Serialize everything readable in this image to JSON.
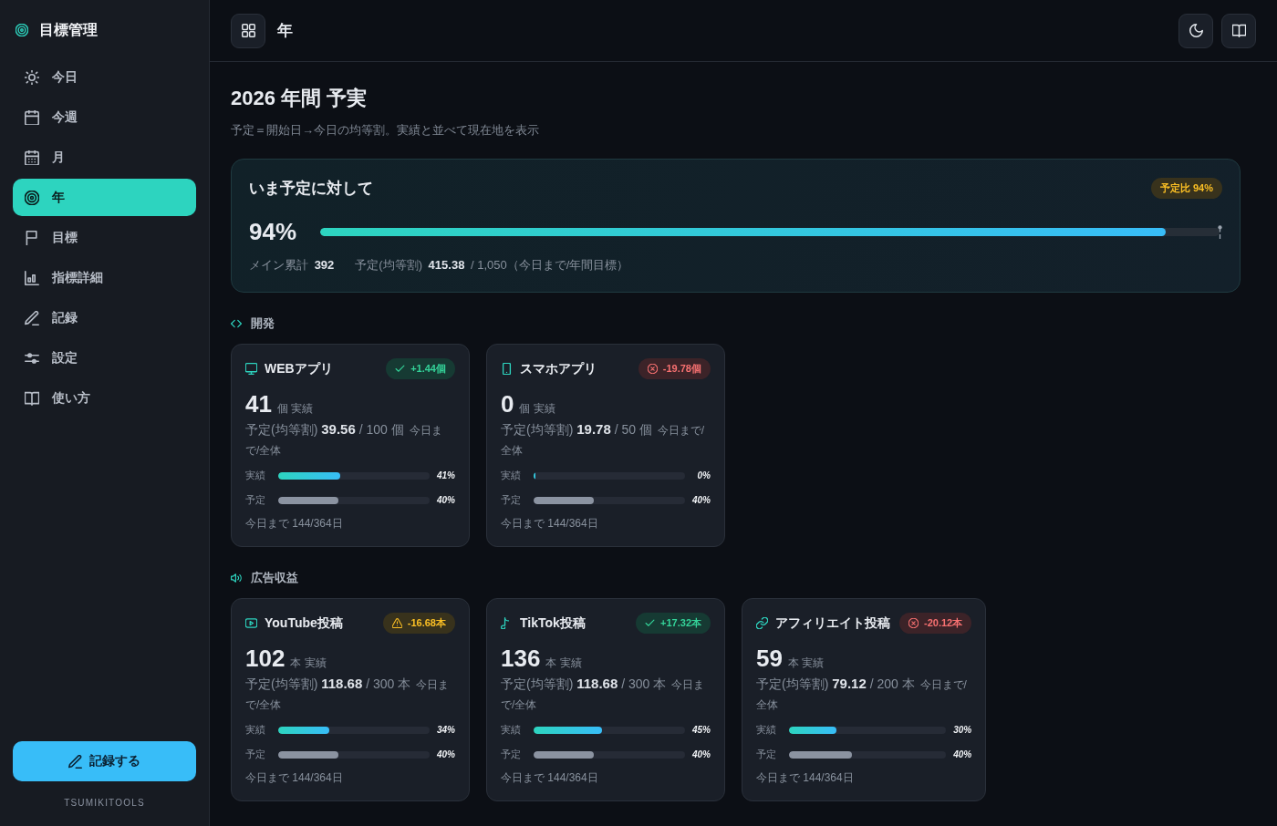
{
  "sidebar": {
    "brand": "目標管理",
    "items": [
      {
        "label": "今日",
        "selected": false
      },
      {
        "label": "今週",
        "selected": false
      },
      {
        "label": "月",
        "selected": false
      },
      {
        "label": "年",
        "selected": true
      },
      {
        "label": "目標",
        "selected": false
      },
      {
        "label": "指標詳細",
        "selected": false
      },
      {
        "label": "記録",
        "selected": false
      },
      {
        "label": "設定",
        "selected": false
      },
      {
        "label": "使い方",
        "selected": false
      }
    ],
    "record_button": "記録する",
    "footer": "TSUMIKITOOLS"
  },
  "header": {
    "title": "年"
  },
  "page": {
    "title": "2026 年間 予実",
    "subtitle": "予定＝開始日→今日の均等割。実績と並べて現在地を表示"
  },
  "summary": {
    "title": "いま予定に対して",
    "badge": {
      "text": "予定比 94%",
      "kind": "warn"
    },
    "percent": "94%",
    "level": 0.94,
    "stats": [
      "メイン累計 **392**",
      "予定(均等割) **415.38** / 1,050（今日まで/年間目標）"
    ]
  },
  "sections": [
    {
      "title": "開発",
      "cards": [
        {
          "name": "WEBアプリ",
          "badge": {
            "text": "+1.44個",
            "kind": "ok"
          },
          "actual": "41",
          "actual_suffix": "個 実績",
          "plan_line": "予定(均等割) **39.56** / 100 個",
          "plan_note": "今日まで/全体",
          "bars": [
            {
              "label": "実績",
              "kind": "actual",
              "level": 0.41,
              "percent": "41%"
            },
            {
              "label": "予定",
              "kind": "plan",
              "level": 0.4,
              "percent": "40%"
            }
          ],
          "progress": "今日まで 144/364日"
        },
        {
          "name": "スマホアプリ",
          "badge": {
            "text": "-19.78個",
            "kind": "bad"
          },
          "actual": "0",
          "actual_suffix": "個 実績",
          "plan_line": "予定(均等割) **19.78** / 50 個",
          "plan_note": "今日まで/全体",
          "bars": [
            {
              "label": "実績",
              "kind": "actual",
              "level": 0,
              "percent": "0%"
            },
            {
              "label": "予定",
              "kind": "plan",
              "level": 0.4,
              "percent": "40%"
            }
          ],
          "progress": "今日まで 144/364日"
        }
      ]
    },
    {
      "title": "広告収益",
      "cards": [
        {
          "name": "YouTube投稿",
          "badge": {
            "text": "-16.68本",
            "kind": "warn"
          },
          "actual": "102",
          "actual_suffix": "本 実績",
          "plan_line": "予定(均等割) **118.68** / 300 本",
          "plan_note": "今日まで/全体",
          "bars": [
            {
              "label": "実績",
              "kind": "actual",
              "level": 0.34,
              "percent": "34%"
            },
            {
              "label": "予定",
              "kind": "plan",
              "level": 0.4,
              "percent": "40%"
            }
          ],
          "progress": "今日まで 144/364日"
        },
        {
          "name": "TikTok投稿",
          "badge": {
            "text": "+17.32本",
            "kind": "ok"
          },
          "actual": "136",
          "actual_suffix": "本 実績",
          "plan_line": "予定(均等割) **118.68** / 300 本",
          "plan_note": "今日まで/全体",
          "bars": [
            {
              "label": "実績",
              "kind": "actual",
              "level": 0.45,
              "percent": "45%"
            },
            {
              "label": "予定",
              "kind": "plan",
              "level": 0.4,
              "percent": "40%"
            }
          ],
          "progress": "今日まで 144/364日"
        },
        {
          "name": "アフィリエイト投稿",
          "badge": {
            "text": "-20.12本",
            "kind": "bad"
          },
          "actual": "59",
          "actual_suffix": "本 実績",
          "plan_line": "予定(均等割) **79.12** / 200 本",
          "plan_note": "今日まで/全体",
          "bars": [
            {
              "label": "実績",
              "kind": "actual",
              "level": 0.3,
              "percent": "30%"
            },
            {
              "label": "予定",
              "kind": "plan",
              "level": 0.4,
              "percent": "40%"
            }
          ],
          "progress": "今日まで 144/364日"
        }
      ]
    }
  ]
}
